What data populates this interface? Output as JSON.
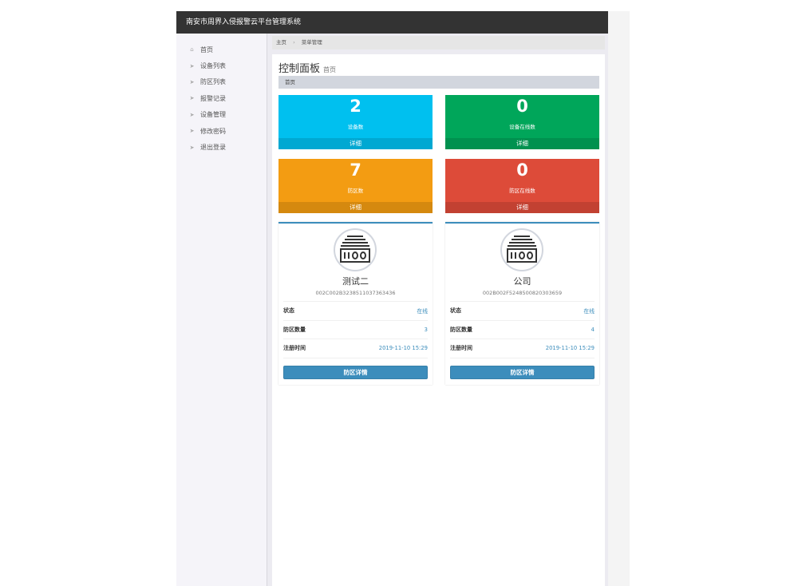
{
  "app": {
    "title": "南安市周界入侵报警云平台管理系统"
  },
  "sidebar": {
    "items": [
      {
        "label": "首页",
        "icon": "home-icon"
      },
      {
        "label": "设备列表",
        "icon": "paper-plane-icon"
      },
      {
        "label": "防区列表",
        "icon": "paper-plane-icon"
      },
      {
        "label": "报警记录",
        "icon": "paper-plane-icon"
      },
      {
        "label": "设备管理",
        "icon": "paper-plane-icon"
      },
      {
        "label": "修改密码",
        "icon": "paper-plane-icon"
      },
      {
        "label": "退出登录",
        "icon": "paper-plane-icon"
      }
    ]
  },
  "breadcrumb": {
    "home": "主页",
    "current": "菜单管理"
  },
  "page": {
    "title": "控制面板",
    "subtitle": "首页",
    "subcrumb": "首页"
  },
  "stats": [
    {
      "value": "2",
      "label": "设备数",
      "footer": "详细",
      "color": "#00c0ef"
    },
    {
      "value": "0",
      "label": "设备在线数",
      "footer": "详细",
      "color": "#00a65a"
    },
    {
      "value": "7",
      "label": "防区数",
      "footer": "详细",
      "color": "#f39c12"
    },
    {
      "value": "0",
      "label": "防区在线数",
      "footer": "详细",
      "color": "#dd4b39"
    }
  ],
  "devices": [
    {
      "name": "测试二",
      "id": "002C002B3238511037363436",
      "rows": [
        {
          "key": "状态",
          "value": "在线"
        },
        {
          "key": "防区数量",
          "value": "3"
        },
        {
          "key": "注册时间",
          "value": "2019-11-10 15:29"
        }
      ],
      "button": "防区详情"
    },
    {
      "name": "公司",
      "id": "002B002F5248500820303659",
      "rows": [
        {
          "key": "状态",
          "value": "在线"
        },
        {
          "key": "防区数量",
          "value": "4"
        },
        {
          "key": "注册时间",
          "value": "2019-11-10 15:29"
        }
      ],
      "button": "防区详情"
    }
  ],
  "colors": {
    "topbar": "#333333",
    "primary": "#3c8dbc",
    "sidebar": "#f5f4f9"
  }
}
